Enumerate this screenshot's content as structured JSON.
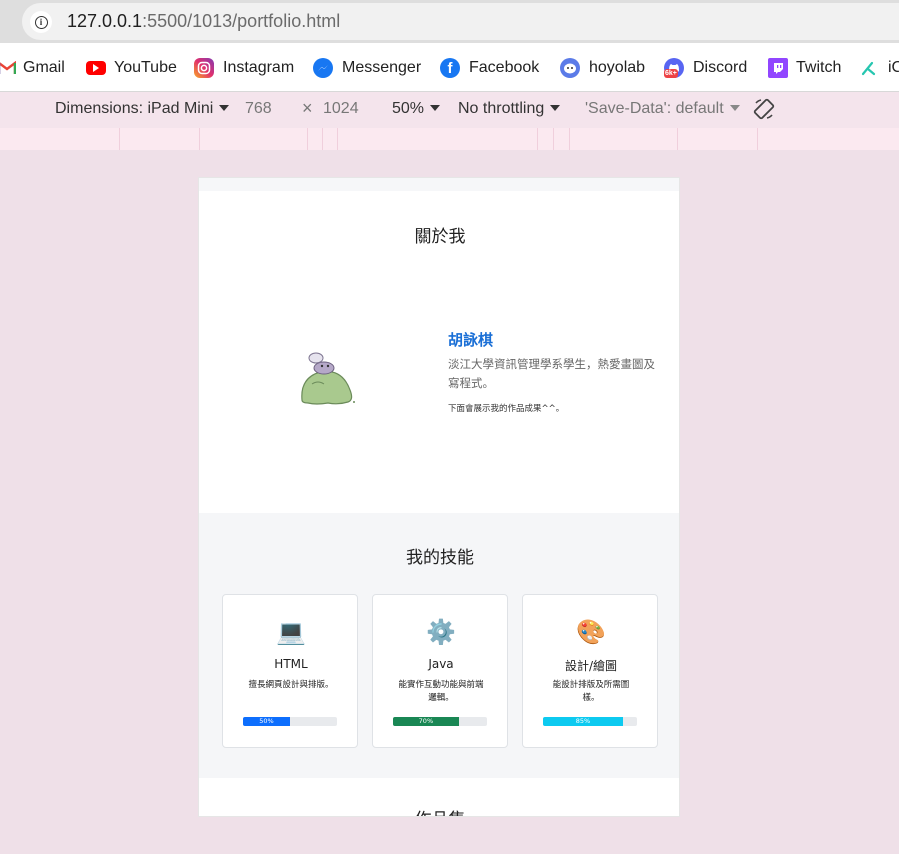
{
  "browser": {
    "url_host": "127.0.0.1",
    "url_rest": ":5500/1013/portfolio.html"
  },
  "bookmarks": [
    {
      "label": "Gmail",
      "icon": "gmail-icon"
    },
    {
      "label": "YouTube",
      "icon": "youtube-icon"
    },
    {
      "label": "Instagram",
      "icon": "instagram-icon"
    },
    {
      "label": "Messenger",
      "icon": "messenger-icon"
    },
    {
      "label": "Facebook",
      "icon": "facebook-icon"
    },
    {
      "label": "hoyolab",
      "icon": "hoyolab-icon"
    },
    {
      "label": "Discord",
      "icon": "discord-icon"
    },
    {
      "label": "Twitch",
      "icon": "twitch-icon"
    },
    {
      "label": "iC",
      "icon": "ic-icon"
    }
  ],
  "bookmark_badges": {
    "discord": "6k+"
  },
  "devtools": {
    "dimensions_label": "Dimensions: iPad Mini",
    "width": "768",
    "times": "×",
    "height": "1024",
    "zoom": "50%",
    "throttling": "No throttling",
    "save_data": "'Save-Data': default"
  },
  "page": {
    "about_title": "關於我",
    "name": "胡詠棋",
    "description": "淡江大學資訊管理學系學生，熱愛畫圖及寫程式。",
    "note": "下面會展示我的作品成果^^。",
    "skills_title": "我的技能",
    "skills": [
      {
        "emoji": "💻",
        "title": "HTML",
        "desc": "擅長網頁設計與排版。",
        "progress": 50,
        "progress_label": "50%",
        "color": "#0d6efd"
      },
      {
        "emoji": "⚙️",
        "title": "Java",
        "desc": "能實作互動功能與前端邏輯。",
        "progress": 70,
        "progress_label": "70%",
        "color": "#198754"
      },
      {
        "emoji": "🎨",
        "title": "設計/繪圖",
        "desc": "能設計排版及所需圖樣。",
        "progress": 85,
        "progress_label": "85%",
        "color": "#0dcaf0"
      }
    ],
    "portfolio_title": "作品集"
  }
}
